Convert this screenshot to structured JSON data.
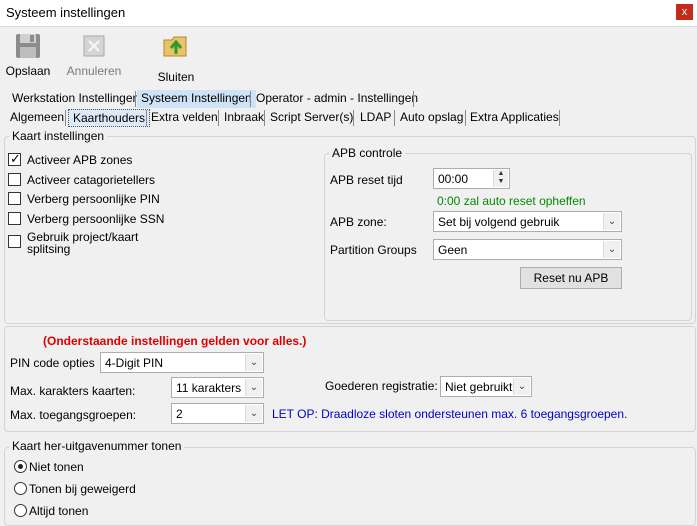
{
  "window": {
    "title": "Systeem instellingen",
    "close_glyph": "x"
  },
  "toolbar": {
    "save_label": "Opslaan",
    "cancel_label": "Annuleren",
    "close_label": "Sluiten"
  },
  "top_tabs": [
    "Werkstation Instellingen",
    "Systeem Instellingen",
    "Operator - admin - Instellingen"
  ],
  "sub_tabs": [
    "Algemeen",
    "Kaarthouders",
    "Extra velden",
    "Inbraak",
    "Script Server(s)",
    "LDAP",
    "Auto opslag",
    "Extra Applicaties"
  ],
  "card_settings": {
    "title": "Kaart instellingen",
    "options": [
      {
        "label": "Activeer APB zones",
        "checked": true
      },
      {
        "label": "Activeer catagorietellers",
        "checked": false
      },
      {
        "label": "Verberg persoonlijke PIN",
        "checked": false
      },
      {
        "label": "Verberg persoonlijke SSN",
        "checked": false
      },
      {
        "label": "Gebruik project/kaart",
        "label2": "splitsing",
        "checked": false
      }
    ]
  },
  "apb": {
    "title": "APB controle",
    "reset_time_label": "APB reset tijd",
    "reset_time_value": "00:00",
    "reset_hint": "0:00 zal auto reset opheffen",
    "zone_label": "APB zone:",
    "zone_value": "Set bij volgend gebruik",
    "partition_label": "Partition Groups",
    "partition_value": "Geen",
    "reset_button": "Reset nu APB"
  },
  "general": {
    "notice": "(Onderstaande instellingen gelden voor alles.)",
    "pin_label": "PIN  code opties",
    "pin_value": "4-Digit PIN",
    "max_chars_label": "Max. karakters kaarten:",
    "max_chars_value": "11 karakters",
    "goods_label": "Goederen registratie:",
    "goods_value": "Niet gebruikt",
    "max_groups_label": "Max. toegangsgroepen:",
    "max_groups_value": "2",
    "wireless_note": "LET OP: Draadloze sloten ondersteunen max. 6 toegangsgroepen."
  },
  "reissue": {
    "title": "Kaart her-uitgavenummer tonen",
    "options": [
      {
        "label": "Niet tonen",
        "checked": true
      },
      {
        "label": "Tonen bij geweigerd",
        "checked": false
      },
      {
        "label": "Altijd tonen",
        "checked": false
      }
    ]
  },
  "colors": {
    "notice_red": "#e00000",
    "hint_green": "#008a00",
    "note_blue": "#0000c8",
    "close_red": "#c42b1c",
    "tab_highlight": "#cfe3f7"
  }
}
